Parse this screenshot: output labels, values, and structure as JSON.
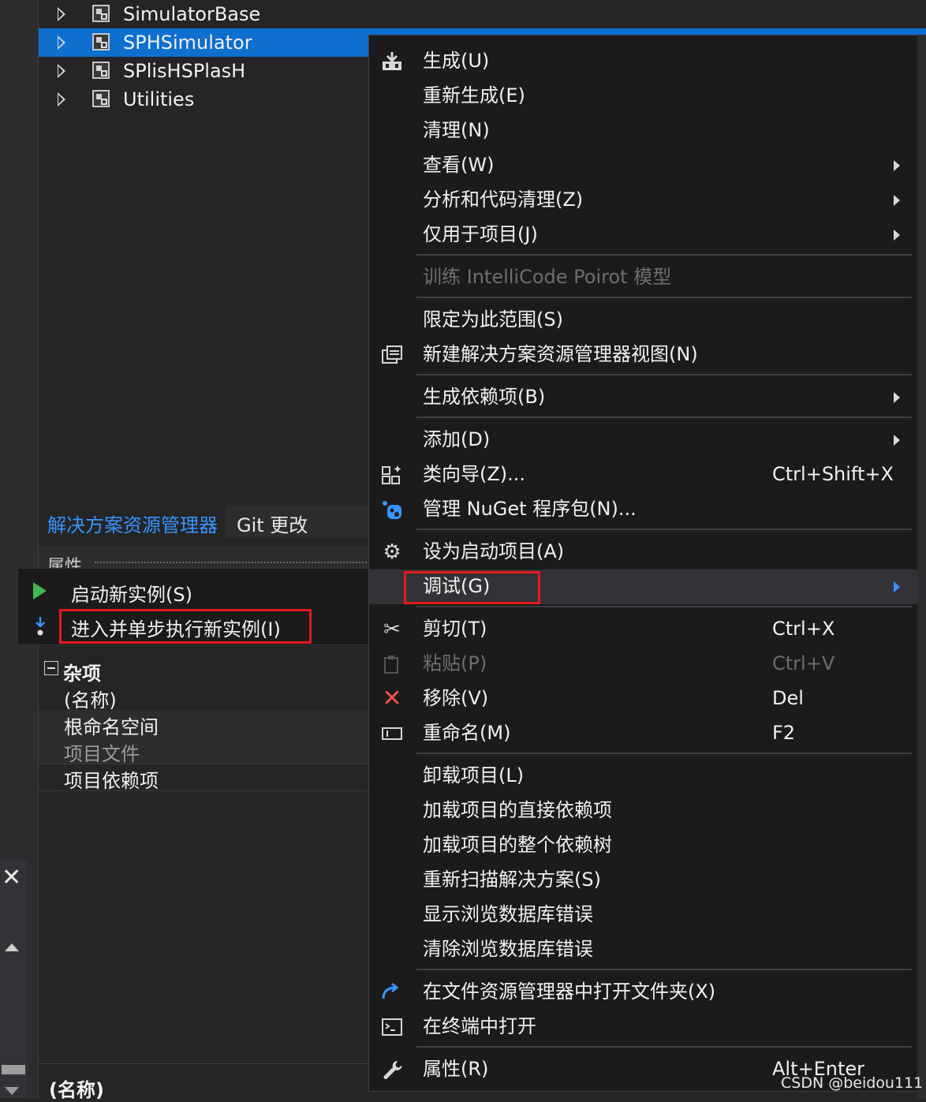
{
  "tree": {
    "items": [
      {
        "label": "SimulatorBase",
        "selected": false
      },
      {
        "label": "SPHSimulator",
        "selected": true
      },
      {
        "label": "SPlisHSPlasH",
        "selected": false
      },
      {
        "label": "Utilities",
        "selected": false
      }
    ]
  },
  "tabs": {
    "solution_explorer": "解决方案资源管理器",
    "git_changes": "Git 更改"
  },
  "properties": {
    "title": "属性",
    "category": "杂项",
    "rows": [
      "(名称)",
      "根命名空间",
      "项目文件",
      "项目依赖项"
    ],
    "bottom_label": "(名称)"
  },
  "submenu": {
    "start_new_instance": "启动新实例(S)",
    "step_into_new_instance": "进入并单步执行新实例(I)"
  },
  "context_menu": {
    "build": "生成(U)",
    "rebuild": "重新生成(E)",
    "clean": "清理(N)",
    "view": "查看(W)",
    "analyze": "分析和代码清理(Z)",
    "project_only": "仅用于项目(J)",
    "train_intellicode": "训练 IntelliCode Poirot 模型",
    "scope_to_this": "限定为此范围(S)",
    "new_view": "新建解决方案资源管理器视图(N)",
    "build_dependencies": "生成依赖项(B)",
    "add": "添加(D)",
    "class_wizard": "类向导(Z)...",
    "class_wizard_shortcut": "Ctrl+Shift+X",
    "manage_nuget": "管理 NuGet 程序包(N)...",
    "set_startup": "设为启动项目(A)",
    "debug": "调试(G)",
    "cut": "剪切(T)",
    "cut_shortcut": "Ctrl+X",
    "paste": "粘贴(P)",
    "paste_shortcut": "Ctrl+V",
    "remove": "移除(V)",
    "remove_shortcut": "Del",
    "rename": "重命名(M)",
    "rename_shortcut": "F2",
    "unload": "卸载项目(L)",
    "load_direct_deps": "加载项目的直接依赖项",
    "load_dep_tree": "加载项目的整个依赖树",
    "rescan": "重新扫描解决方案(S)",
    "show_browse_errors": "显示浏览数据库错误",
    "clear_browse_errors": "清除浏览数据库错误",
    "open_in_explorer": "在文件资源管理器中打开文件夹(X)",
    "open_in_terminal": "在终端中打开",
    "properties": "属性(R)",
    "properties_shortcut": "Alt+Enter"
  },
  "watermark": "CSDN @beidou111",
  "colors": {
    "selection": "#0e6fcf",
    "highlight_box": "#e51b1b",
    "accent": "#3794ff"
  }
}
